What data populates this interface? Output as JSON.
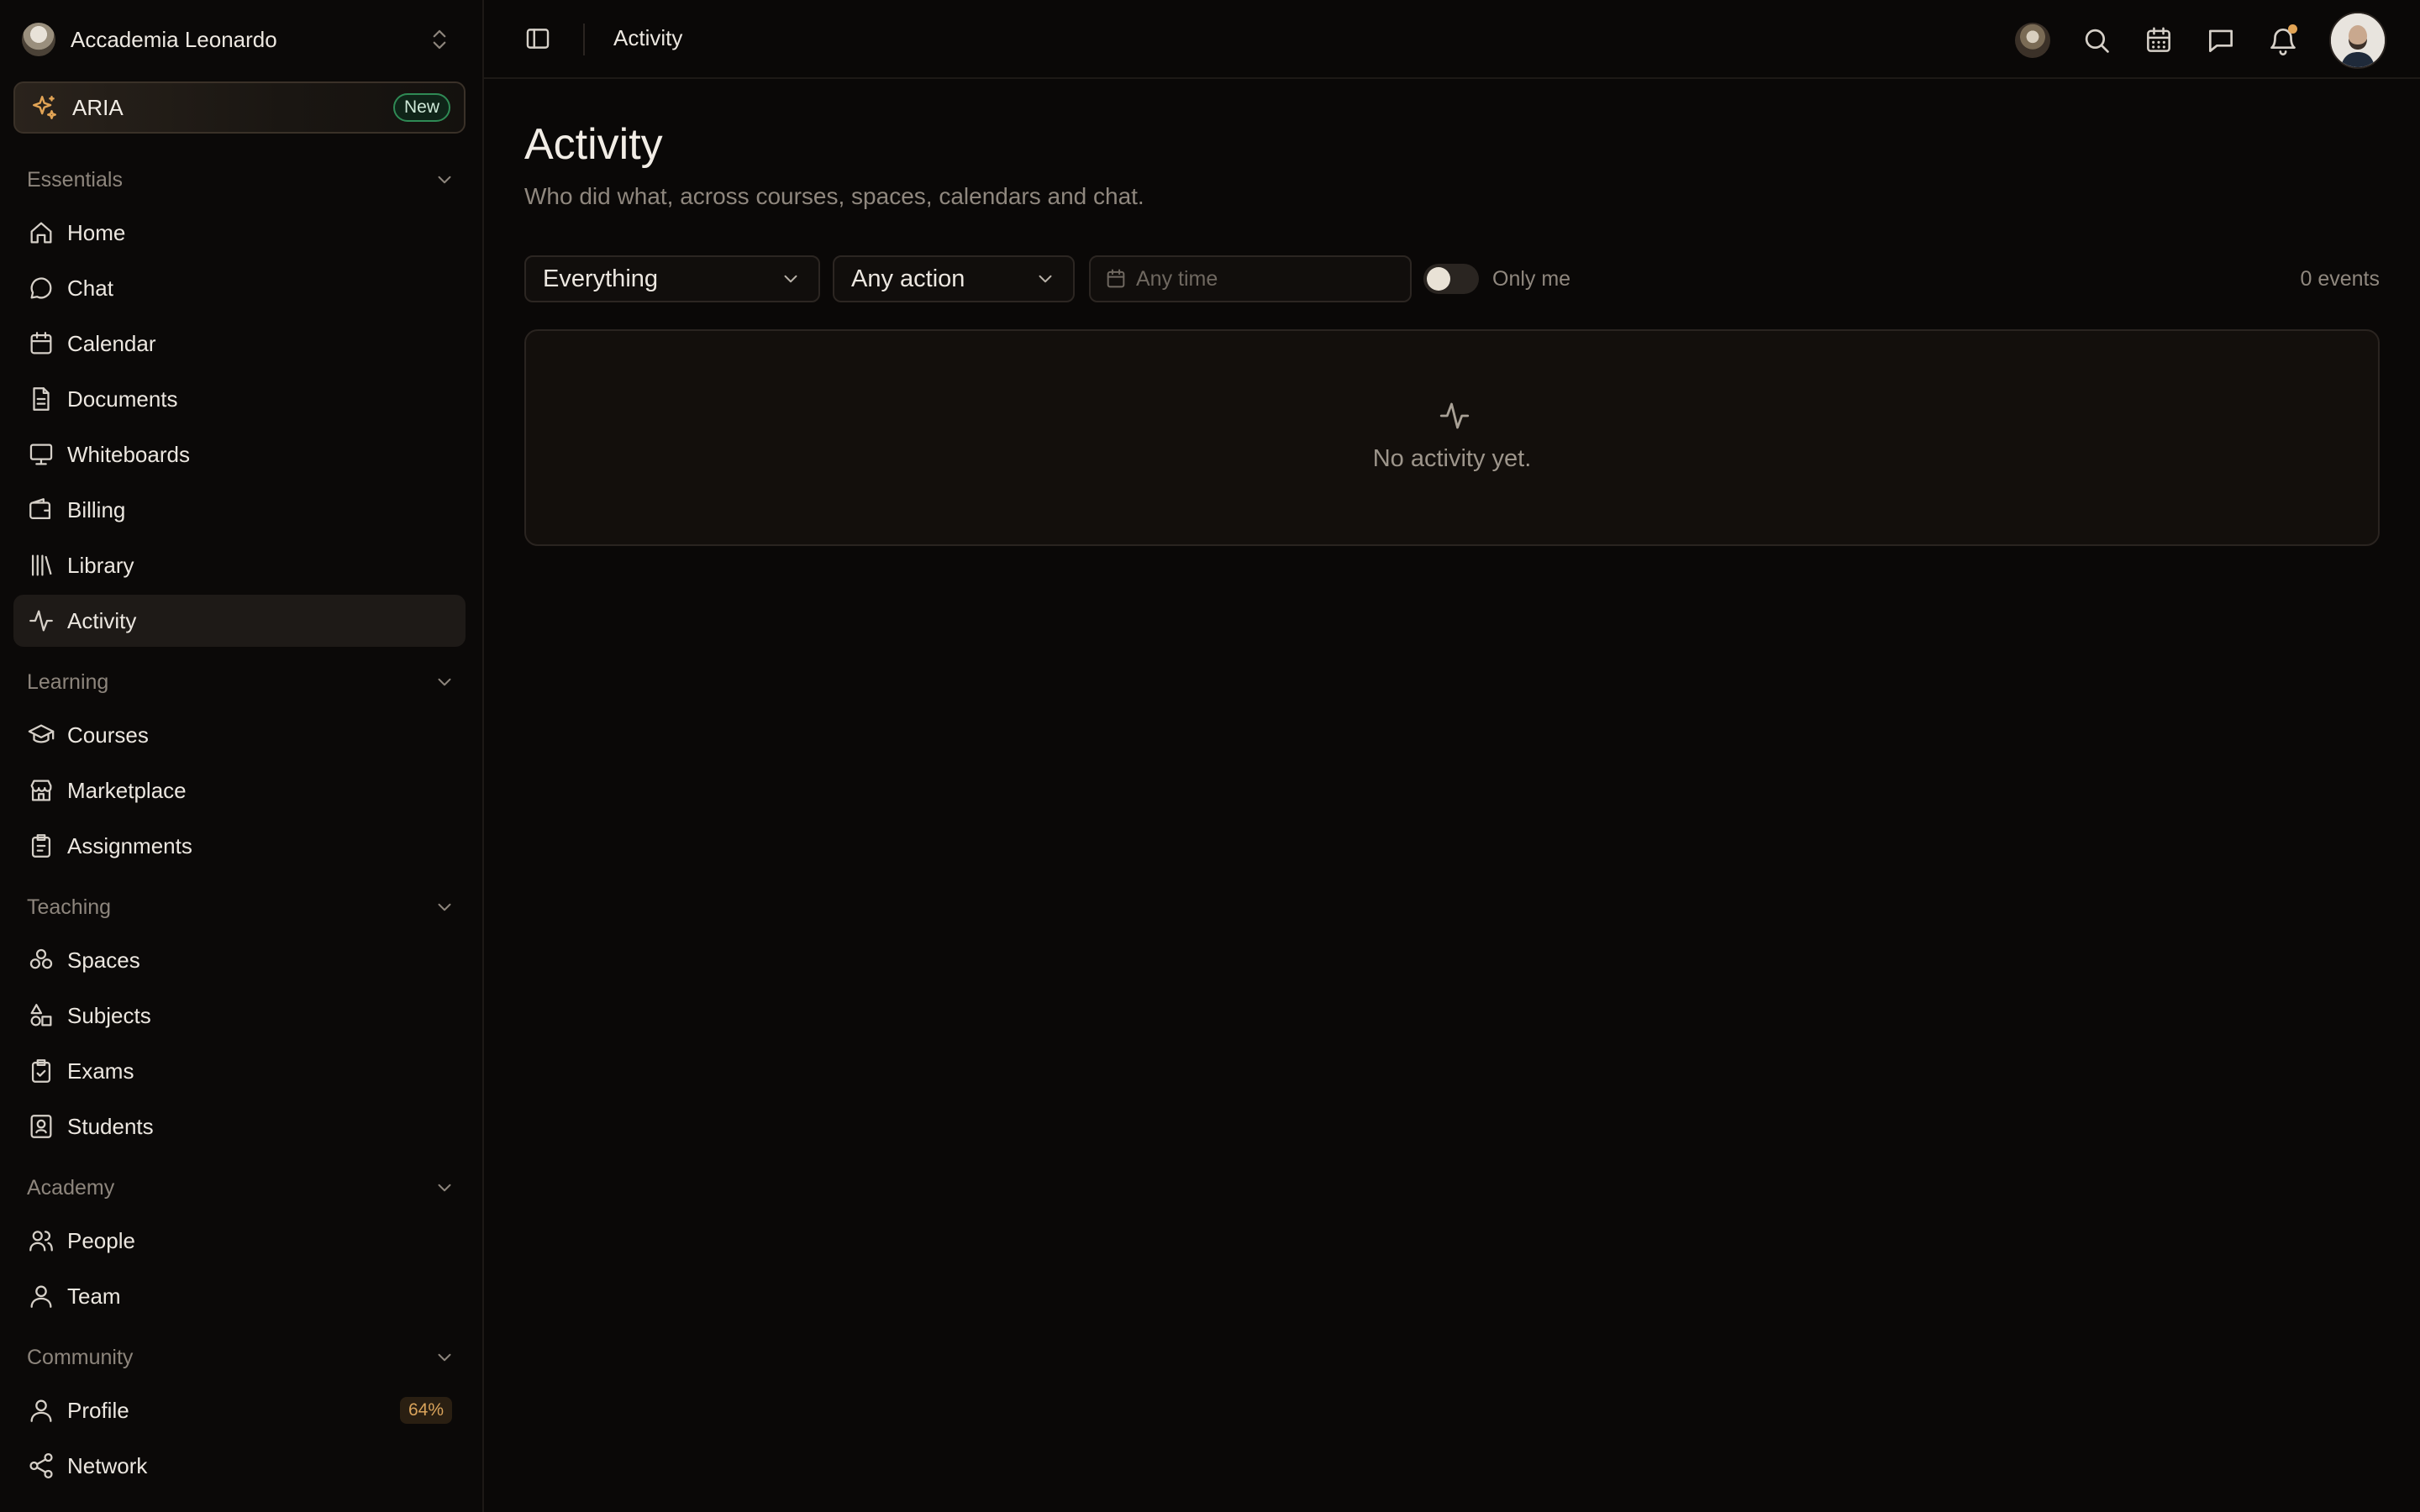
{
  "workspace": {
    "name": "Accademia Leonardo"
  },
  "aria": {
    "label": "ARIA",
    "badge": "New"
  },
  "sidebar": {
    "sections": [
      {
        "title": "Essentials",
        "items": [
          {
            "label": "Home",
            "icon": "home-icon"
          },
          {
            "label": "Chat",
            "icon": "chat-icon"
          },
          {
            "label": "Calendar",
            "icon": "calendar-icon"
          },
          {
            "label": "Documents",
            "icon": "document-icon"
          },
          {
            "label": "Whiteboards",
            "icon": "whiteboard-icon"
          },
          {
            "label": "Billing",
            "icon": "wallet-icon"
          },
          {
            "label": "Library",
            "icon": "library-icon"
          },
          {
            "label": "Activity",
            "icon": "activity-icon",
            "active": true
          }
        ]
      },
      {
        "title": "Learning",
        "items": [
          {
            "label": "Courses",
            "icon": "graduation-cap-icon"
          },
          {
            "label": "Marketplace",
            "icon": "store-icon"
          },
          {
            "label": "Assignments",
            "icon": "clipboard-icon"
          }
        ]
      },
      {
        "title": "Teaching",
        "items": [
          {
            "label": "Spaces",
            "icon": "spaces-icon"
          },
          {
            "label": "Subjects",
            "icon": "shapes-icon"
          },
          {
            "label": "Exams",
            "icon": "clipboard-check-icon"
          },
          {
            "label": "Students",
            "icon": "contact-icon"
          }
        ]
      },
      {
        "title": "Academy",
        "items": [
          {
            "label": "People",
            "icon": "users-icon"
          },
          {
            "label": "Team",
            "icon": "user-icon"
          }
        ]
      },
      {
        "title": "Community",
        "items": [
          {
            "label": "Profile",
            "icon": "user-icon",
            "badge": "64%"
          },
          {
            "label": "Network",
            "icon": "share-icon"
          }
        ]
      }
    ]
  },
  "topbar": {
    "title": "Activity"
  },
  "page": {
    "title": "Activity",
    "subtitle": "Who did what, across courses, spaces, calendars and chat."
  },
  "filters": {
    "scope": "Everything",
    "action": "Any action",
    "time_placeholder": "Any time",
    "only_me_label": "Only me",
    "only_me": false,
    "events_count": "0 events"
  },
  "empty": {
    "text": "No activity yet."
  },
  "colors": {
    "accent": "#e2a455",
    "badge_green": "#2f8a55",
    "background": "#0a0807"
  }
}
